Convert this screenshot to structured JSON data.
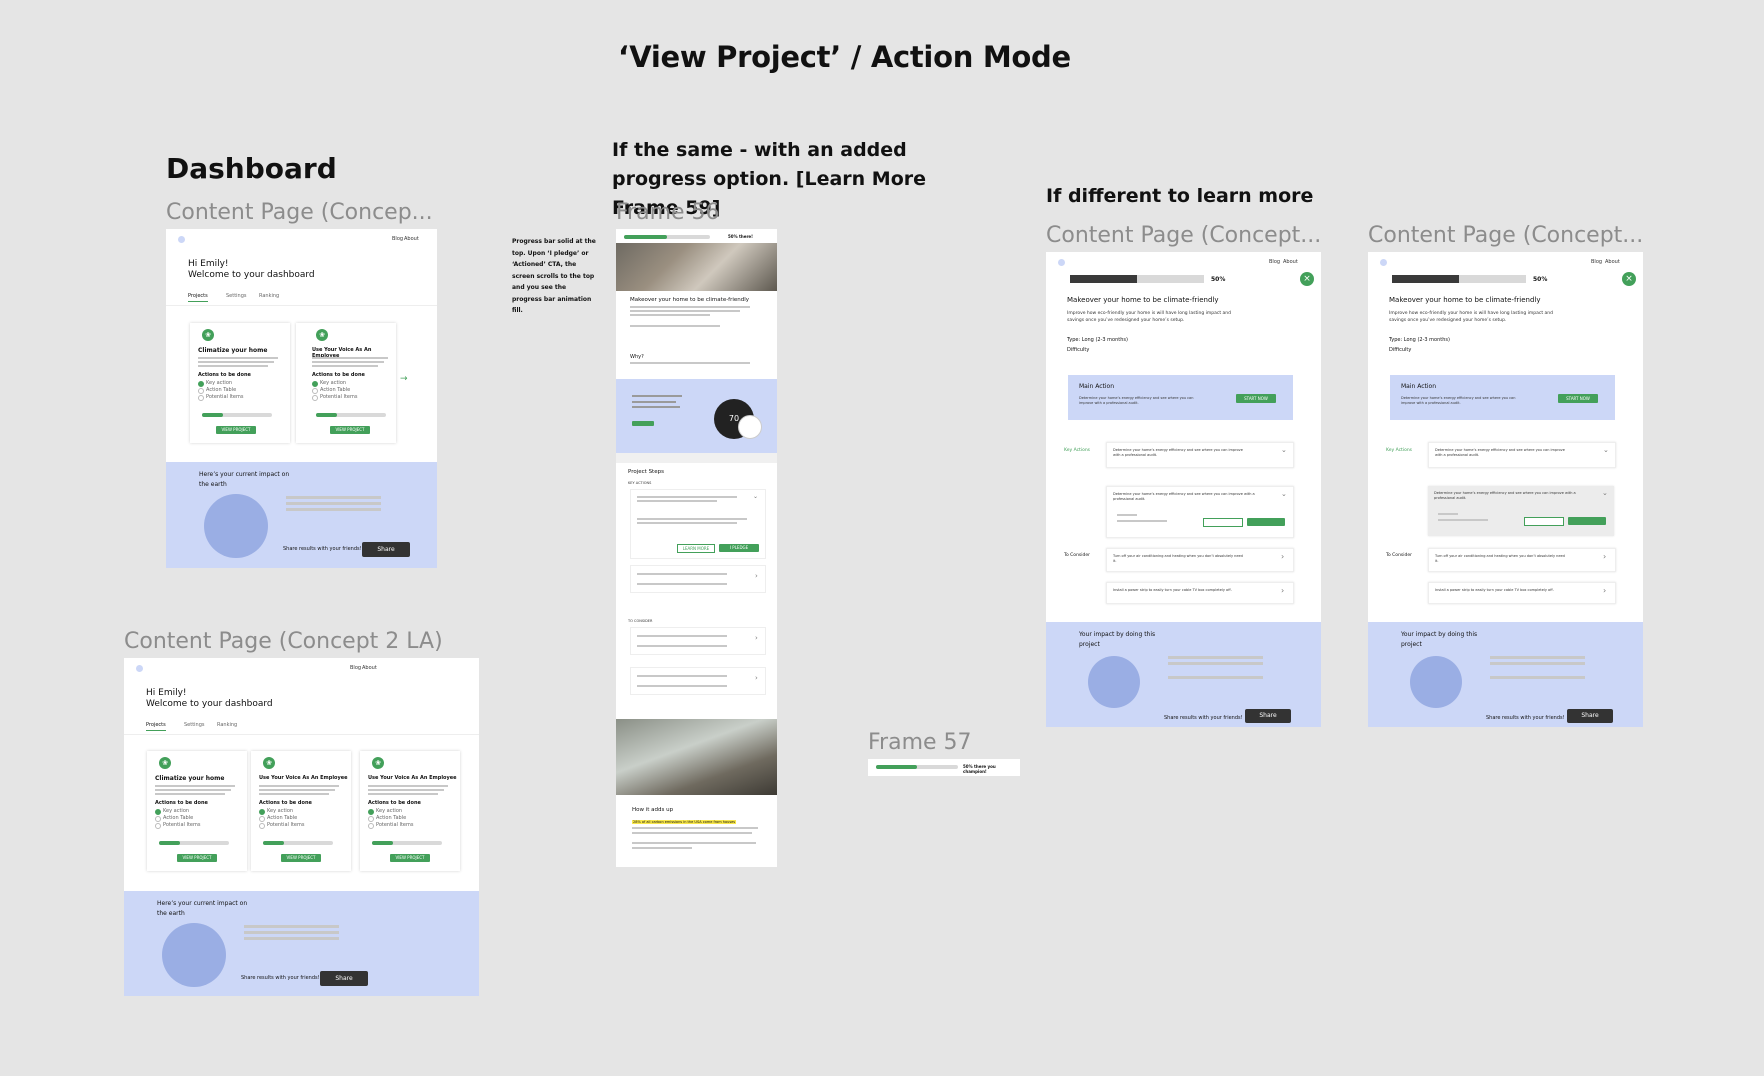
{
  "page_title": "‘View Project’ / Action Mode",
  "dashboard_heading": "Dashboard",
  "notes": {
    "same": "If the same - with an added progress option. [Learn More Frame 59]",
    "different": "If different to learn more",
    "progress": "Progress bar solid at the top. Upon ‘I pledge’ or ‘Actioned’ CTA, the screen scrolls to the top and you see the progress bar animation fill."
  },
  "frame_labels": {
    "content_page_a": "Content Page (Concep...",
    "content_page_2la": "Content Page (Concept 2 LA)",
    "frame56": "Frame 56",
    "frame57": "Frame 57",
    "content_page_b": "Content Page (Concept...",
    "content_page_c": "Content Page (Concept..."
  },
  "nav": {
    "blog": "Blog",
    "about": "About"
  },
  "dashboard": {
    "greeting": "Hi Emily!",
    "welcome": "Welcome to your dashboard",
    "tabs": [
      "Projects",
      "Settings",
      "Ranking"
    ],
    "cards": [
      {
        "title": "Climatize your home",
        "progress": 0.3
      },
      {
        "title": "Use Your Voice As An Employee",
        "progress": 0.3
      },
      {
        "title": "Use Your Voice As An Employee",
        "progress": 0.3
      }
    ],
    "actions_label": "Actions to be done",
    "action_items": [
      "Key action",
      "Action Table",
      "Potential Items"
    ],
    "view_button": "VIEW PROJECT",
    "impact_title": "Here’s your current impact on the earth",
    "share_text": "Share results with your friends!",
    "share_button": "Share"
  },
  "frame56": {
    "progress_text": "50% there!",
    "progress": 0.5,
    "headline": "Makeover your home to be climate-friendly",
    "why": "Why?",
    "thermostat_reading": "70",
    "project_steps": "Project Steps",
    "key_actions_label": "KEY ACTIONS",
    "to_consider_label": "TO CONSIDER",
    "how_it_adds_up": "How it adds up",
    "highlight_text": "28% of all carbon emissions in the USA come from houses",
    "learn_more": "LEARN MORE",
    "pledge": "I PLEDGE"
  },
  "frame57": {
    "progress_text": "50% there you champion!",
    "progress": 0.5
  },
  "content_b": {
    "progress_pct": "50%",
    "progress": 0.5,
    "headline": "Makeover your home to be climate-friendly",
    "intro": "Improve how eco-friendly your home is will have long lasting impact and savings once you’ve redesigned your home’s setup.",
    "type": "Type: Long (2-3 months)",
    "difficulty": "Difficulty",
    "main_action": "Main Action",
    "main_action_desc": "Determine your home’s energy efficiency and see where you can improve with a professional audit.",
    "main_action_btn": "START NOW",
    "key_actions": "Key Actions",
    "key_action_1": "Determine your home’s energy efficiency and see where you can improve with a professional audit.",
    "key_action_2": "Determine your home’s energy efficiency and see where you can improve with a professional audit.",
    "to_consider": "To Consider",
    "consider_1": "Turn off your air conditioning and heating when you don’t absolutely need it.",
    "consider_2": "Install a power strip to easily turn your cable TV box completely off.",
    "impact": "Your impact by doing this project",
    "share_text": "Share results with your friends!",
    "share_button": "Share"
  }
}
